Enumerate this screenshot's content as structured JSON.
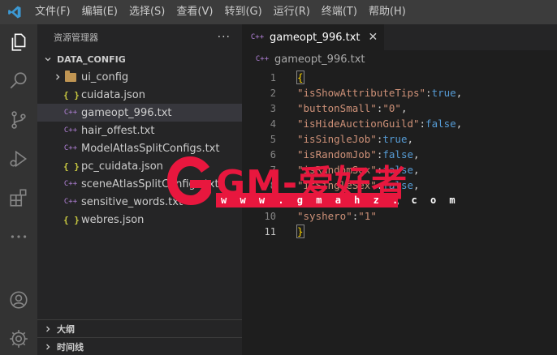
{
  "menu": [
    "文件(F)",
    "编辑(E)",
    "选择(S)",
    "查看(V)",
    "转到(G)",
    "运行(R)",
    "终端(T)",
    "帮助(H)"
  ],
  "sidebar": {
    "title": "资源管理器",
    "more": "···",
    "folder": "DATA_CONFIG",
    "items": [
      {
        "name": "ui_config",
        "type": "folder"
      },
      {
        "name": "cuidata.json",
        "type": "json"
      },
      {
        "name": "gameopt_996.txt",
        "type": "txt",
        "selected": true
      },
      {
        "name": "hair_offest.txt",
        "type": "txt"
      },
      {
        "name": "ModelAtlasSplitConfigs.txt",
        "type": "txt"
      },
      {
        "name": "pc_cuidata.json",
        "type": "json"
      },
      {
        "name": "sceneAtlasSplitConfigs.txt",
        "type": "txt"
      },
      {
        "name": "sensitive_words.txt",
        "type": "txt"
      },
      {
        "name": "webres.json",
        "type": "json"
      }
    ],
    "outline": "大纲",
    "timeline": "时间线"
  },
  "editor": {
    "tab_label": "gameopt_996.txt",
    "breadcrumb": "gameopt_996.txt",
    "icon_glyph": "C++",
    "json_glyph": "{ }"
  },
  "code_lines": [
    {
      "n": "1",
      "tokens": [
        {
          "t": "{",
          "c": "tk-brace"
        }
      ]
    },
    {
      "n": "2",
      "tokens": [
        {
          "t": "\"isShowAttributeTips\"",
          "c": "tk-str"
        },
        {
          "t": ":",
          "c": "tk-punc"
        },
        {
          "t": "true",
          "c": "tk-kw"
        },
        {
          "t": ",",
          "c": "tk-punc"
        }
      ]
    },
    {
      "n": "3",
      "tokens": [
        {
          "t": "\"buttonSmall\"",
          "c": "tk-str"
        },
        {
          "t": ":",
          "c": "tk-punc"
        },
        {
          "t": "\"0\"",
          "c": "tk-str"
        },
        {
          "t": ",",
          "c": "tk-punc"
        }
      ]
    },
    {
      "n": "4",
      "tokens": [
        {
          "t": "\"isHideAuctionGuild\"",
          "c": "tk-str"
        },
        {
          "t": ":",
          "c": "tk-punc"
        },
        {
          "t": "false",
          "c": "tk-kw"
        },
        {
          "t": ",",
          "c": "tk-punc"
        }
      ]
    },
    {
      "n": "5",
      "tokens": [
        {
          "t": "\"isSingleJob\"",
          "c": "tk-str"
        },
        {
          "t": ":",
          "c": "tk-punc"
        },
        {
          "t": "true",
          "c": "tk-kw"
        },
        {
          "t": ",",
          "c": "tk-punc"
        }
      ]
    },
    {
      "n": "6",
      "tokens": [
        {
          "t": "\"isRandomJob\"",
          "c": "tk-str"
        },
        {
          "t": ":",
          "c": "tk-punc"
        },
        {
          "t": "false",
          "c": "tk-kw"
        },
        {
          "t": ",",
          "c": "tk-punc"
        }
      ]
    },
    {
      "n": "7",
      "tokens": [
        {
          "t": "\"isRandomSex\"",
          "c": "tk-str"
        },
        {
          "t": ":",
          "c": "tk-punc"
        },
        {
          "t": "false",
          "c": "tk-kw"
        },
        {
          "t": ",",
          "c": "tk-punc"
        }
      ]
    },
    {
      "n": "8",
      "tokens": [
        {
          "t": "\"isSingleSex\"",
          "c": "tk-str"
        },
        {
          "t": ":",
          "c": "tk-punc"
        },
        {
          "t": "false",
          "c": "tk-kw"
        },
        {
          "t": ",",
          "c": "tk-punc"
        }
      ]
    },
    {
      "n": "9",
      "tokens": [
        {
          "t": "\"serverName\"",
          "c": "tk-str"
        },
        {
          "t": ":",
          "c": "tk-punc"
        },
        {
          "t": "\"1\"",
          "c": "tk-str"
        },
        {
          "t": ",",
          "c": "tk-punc"
        }
      ]
    },
    {
      "n": "10",
      "tokens": [
        {
          "t": "\"syshero\"",
          "c": "tk-str"
        },
        {
          "t": ":",
          "c": "tk-punc"
        },
        {
          "t": "\"1\"",
          "c": "tk-str"
        }
      ]
    },
    {
      "n": "11",
      "tokens": [
        {
          "t": "}",
          "c": "tk-brace"
        }
      ],
      "active": true
    }
  ],
  "watermark": {
    "title": "GM-爱好者",
    "url": "w w w . g m a h z . c o m"
  },
  "colors": {
    "accent_watermark": "#e8173e",
    "activity_bar": "#333333",
    "sidebar": "#252526",
    "editor": "#1e1e1e"
  }
}
